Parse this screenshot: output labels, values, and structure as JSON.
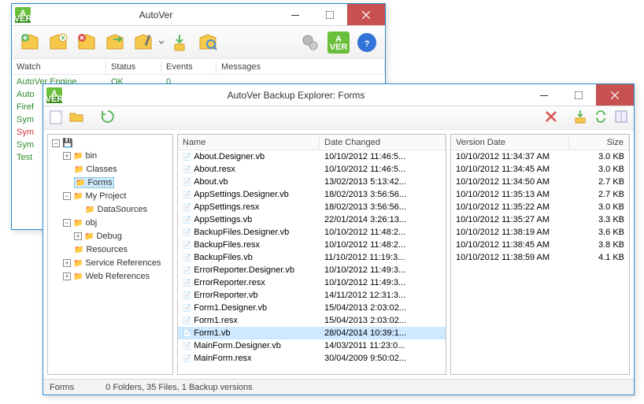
{
  "w1": {
    "title": "AutoVer",
    "headers": {
      "watch": "Watch",
      "status": "Status",
      "events": "Events",
      "messages": "Messages"
    },
    "rows": [
      {
        "watch": "AutoVer Engine",
        "status": "OK",
        "events": "0",
        "cls": "c-green"
      },
      {
        "watch": "Auto",
        "cls": "c-green"
      },
      {
        "watch": "Firef",
        "cls": "c-green"
      },
      {
        "watch": "Sym",
        "cls": "c-green"
      },
      {
        "watch": "Sym",
        "cls": "c-red"
      },
      {
        "watch": "Sym",
        "cls": "c-green"
      },
      {
        "watch": "Test",
        "cls": "c-green"
      }
    ]
  },
  "w2": {
    "title": "AutoVer Backup Explorer: Forms",
    "tree": [
      {
        "label": "",
        "root": true,
        "expanded": true,
        "children": [
          {
            "label": "bin",
            "toggle": "+"
          },
          {
            "label": "Classes"
          },
          {
            "label": "Forms",
            "selected": true
          },
          {
            "label": "My Project",
            "toggle": "-",
            "children": [
              {
                "label": "DataSources"
              }
            ]
          },
          {
            "label": "obj",
            "toggle": "-",
            "children": [
              {
                "label": "Debug",
                "toggle": "+"
              }
            ]
          },
          {
            "label": "Resources"
          },
          {
            "label": "Service References",
            "toggle": "+"
          },
          {
            "label": "Web References",
            "toggle": "+"
          }
        ]
      }
    ],
    "fileHeaders": {
      "name": "Name",
      "date": "Date Changed"
    },
    "files": [
      {
        "name": "About.Designer.vb",
        "date": "10/10/2012 11:46:5..."
      },
      {
        "name": "About.resx",
        "date": "10/10/2012 11:46:5..."
      },
      {
        "name": "About.vb",
        "date": "13/02/2013 5:13:42..."
      },
      {
        "name": "AppSettings.Designer.vb",
        "date": "18/02/2013 3:56:56..."
      },
      {
        "name": "AppSettings.resx",
        "date": "18/02/2013 3:56:56..."
      },
      {
        "name": "AppSettings.vb",
        "date": "22/01/2014 3:26:13..."
      },
      {
        "name": "BackupFiles.Designer.vb",
        "date": "10/10/2012 11:48:2..."
      },
      {
        "name": "BackupFiles.resx",
        "date": "10/10/2012 11:48:2..."
      },
      {
        "name": "BackupFiles.vb",
        "date": "11/10/2012 11:19:3..."
      },
      {
        "name": "ErrorReporter.Designer.vb",
        "date": "10/10/2012 11:49:3..."
      },
      {
        "name": "ErrorReporter.resx",
        "date": "10/10/2012 11:49:3..."
      },
      {
        "name": "ErrorReporter.vb",
        "date": "14/11/2012 12:31:3..."
      },
      {
        "name": "Form1.Designer.vb",
        "date": "15/04/2013 2:03:02..."
      },
      {
        "name": "Form1.resx",
        "date": "15/04/2013 2:03:02..."
      },
      {
        "name": "Form1.vb",
        "date": "28/04/2014 10:39:1...",
        "selected": true
      },
      {
        "name": "MainForm.Designer.vb",
        "date": "14/03/2011 11:23:0..."
      },
      {
        "name": "MainForm.resx",
        "date": "30/04/2009 9:50:02..."
      }
    ],
    "verHeaders": {
      "date": "Version Date",
      "size": "Size"
    },
    "versions": [
      {
        "date": "10/10/2012 11:34:37 AM",
        "size": "3.0 KB"
      },
      {
        "date": "10/10/2012 11:34:45 AM",
        "size": "3.0 KB"
      },
      {
        "date": "10/10/2012 11:34:50 AM",
        "size": "2.7 KB"
      },
      {
        "date": "10/10/2012 11:35:13 AM",
        "size": "2.7 KB"
      },
      {
        "date": "10/10/2012 11:35:22 AM",
        "size": "3.0 KB"
      },
      {
        "date": "10/10/2012 11:35:27 AM",
        "size": "3.3 KB"
      },
      {
        "date": "10/10/2012 11:38:19 AM",
        "size": "3.6 KB"
      },
      {
        "date": "10/10/2012 11:38:45 AM",
        "size": "3.8 KB"
      },
      {
        "date": "10/10/2012 11:38:59 AM",
        "size": "4.1 KB"
      }
    ],
    "status": {
      "path": "Forms",
      "summary": "0 Folders, 35 Files, 1 Backup versions"
    }
  }
}
